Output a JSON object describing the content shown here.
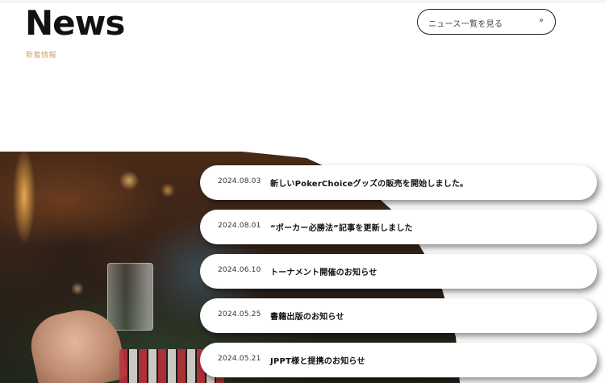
{
  "header": {
    "title": "News",
    "subtitle": "新着情報"
  },
  "view_all": {
    "label": "ニュース一覧を見る",
    "icon": "»"
  },
  "news": [
    {
      "date": "2024.08.03",
      "text": "新しいPokerChoiceグッズの販売を開始しました。"
    },
    {
      "date": "2024.08.01",
      "text": "“ポーカー必勝法”記事を更新しました"
    },
    {
      "date": "2024.06.10",
      "text": "トーナメント開催のお知らせ"
    },
    {
      "date": "2024.05.25",
      "text": "書籍出版のお知らせ"
    },
    {
      "date": "2024.05.21",
      "text": "JPPT様と提携のお知らせ"
    }
  ]
}
